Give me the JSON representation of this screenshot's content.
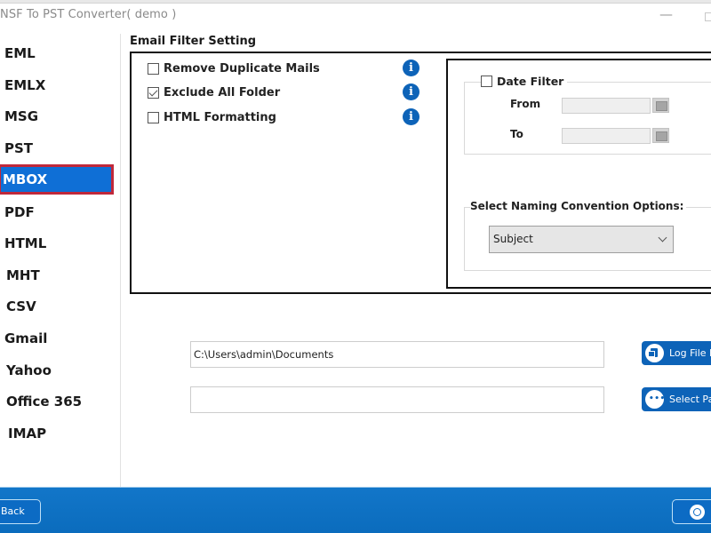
{
  "window": {
    "title": "NSF To PST Converter( demo )",
    "minimize_glyph": "—"
  },
  "sidebar": {
    "selected": "MBOX",
    "items": [
      {
        "label": "EML"
      },
      {
        "label": "EMLX"
      },
      {
        "label": "MSG"
      },
      {
        "label": "PST"
      },
      {
        "label": "MBOX"
      },
      {
        "label": "PDF"
      },
      {
        "label": "HTML"
      },
      {
        "label": "MHT"
      },
      {
        "label": "CSV"
      },
      {
        "label": "Gmail"
      },
      {
        "label": "Yahoo"
      },
      {
        "label": "Office 365"
      },
      {
        "label": "IMAP"
      }
    ]
  },
  "email_filter": {
    "title": "Email Filter Setting",
    "options": [
      {
        "label": "Remove Duplicate Mails",
        "checked": false,
        "info_icon": "info-icon"
      },
      {
        "label": "Exclude All Folder",
        "checked": true,
        "info_icon": "info-icon"
      },
      {
        "label": "HTML Formatting",
        "checked": false,
        "info_icon": "info-icon"
      }
    ],
    "info_glyph": "i"
  },
  "date_filter": {
    "label": "Date Filter",
    "checked": false,
    "from_label": "From",
    "to_label": "To",
    "from_value": "",
    "to_value": ""
  },
  "naming": {
    "label": "Select Naming Convention Options:",
    "selected": "Subject"
  },
  "paths": {
    "log_path_value": "C:\\Users\\admin\\Documents",
    "destination_value": "",
    "log_button_label": "Log File Path",
    "select_button_label": "Select Path",
    "dots_glyph": "•••"
  },
  "footer": {
    "back_label": "Back",
    "help_icon": "lifebuoy-icon"
  },
  "colors": {
    "accent": "#0d63b8",
    "selected_item_bg": "#0f6fd6",
    "selected_item_border": "#c0283a",
    "footer_bg": "#0b6cbd"
  }
}
